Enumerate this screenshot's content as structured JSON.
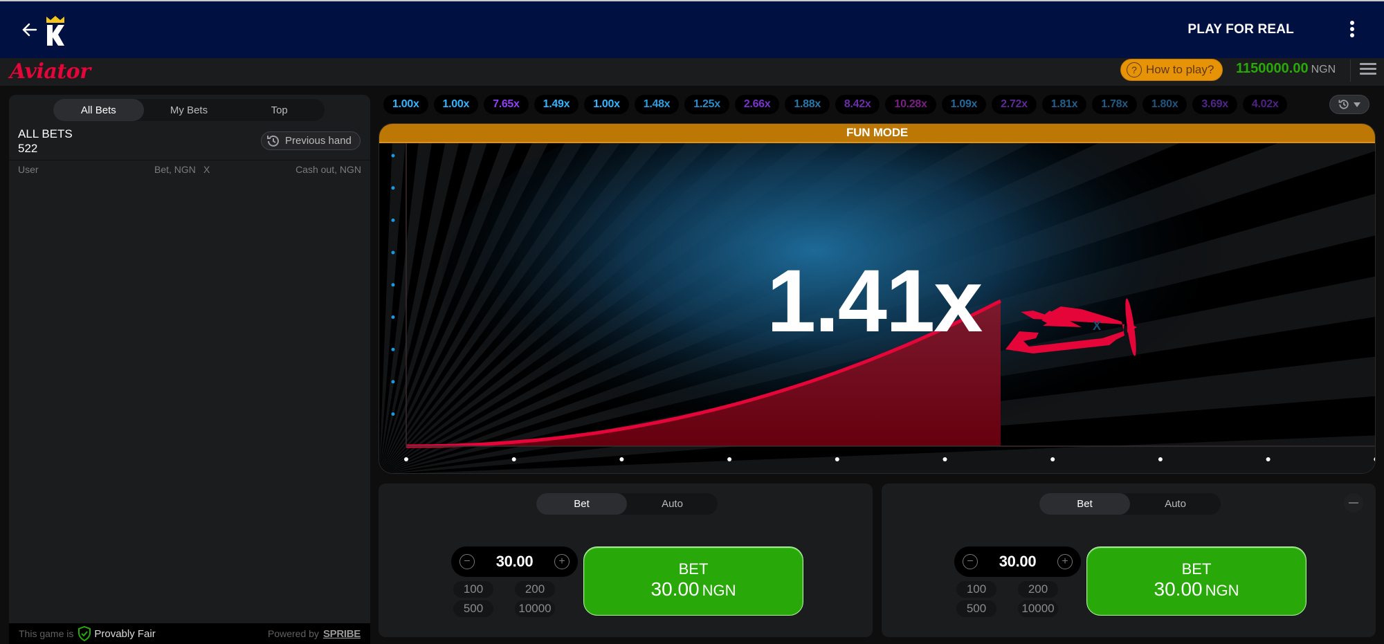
{
  "topnav": {
    "back_icon": "arrow-left-icon",
    "logo_icon": "crown-k-logo-icon",
    "play_for_real": "PLAY FOR REAL",
    "more_icon": "kebab-menu-icon"
  },
  "gamebar": {
    "logo_text": "Aviator",
    "how_to_play": "How to play?",
    "how_to_play_icon": "question-circle-icon",
    "balance": "1150000.00",
    "currency": "NGN",
    "menu_icon": "hamburger-menu-icon"
  },
  "bets_panel": {
    "tabs": [
      {
        "label": "All Bets",
        "active": true
      },
      {
        "label": "My Bets",
        "active": false
      },
      {
        "label": "Top",
        "active": false
      }
    ],
    "title": "ALL BETS",
    "count": "522",
    "previous_hand": "Previous hand",
    "columns": {
      "user": "User",
      "bet": "Bet, NGN",
      "x": "X",
      "cashout": "Cash out, NGN"
    },
    "rows": [],
    "footer": {
      "prefix": "This game is",
      "provably_fair": "Provably Fair",
      "powered_by": "Powered by",
      "provider": "SPRIBE"
    }
  },
  "history": {
    "multipliers": [
      {
        "value": "1.00x",
        "color": "#34b4ff"
      },
      {
        "value": "1.00x",
        "color": "#34b4ff"
      },
      {
        "value": "7.65x",
        "color": "#913ef8"
      },
      {
        "value": "1.49x",
        "color": "#34b4ff"
      },
      {
        "value": "1.00x",
        "color": "#34b4ff"
      },
      {
        "value": "1.48x",
        "color": "#2f9ee0"
      },
      {
        "value": "1.25x",
        "color": "#2b8cc7"
      },
      {
        "value": "2.66x",
        "color": "#7a33cf"
      },
      {
        "value": "1.88x",
        "color": "#2877a8"
      },
      {
        "value": "8.42x",
        "color": "#6a2ea8"
      },
      {
        "value": "10.28x",
        "color": "#7a1f83"
      },
      {
        "value": "1.09x",
        "color": "#25699a"
      },
      {
        "value": "2.72x",
        "color": "#5e2a99"
      },
      {
        "value": "1.81x",
        "color": "#235f8c"
      },
      {
        "value": "1.78x",
        "color": "#225a86"
      },
      {
        "value": "1.80x",
        "color": "#21557f"
      },
      {
        "value": "3.69x",
        "color": "#52258a"
      },
      {
        "value": "4.02x",
        "color": "#4e2384"
      }
    ],
    "history_toggle_icon": "history-clock-icon"
  },
  "game": {
    "mode_banner": "FUN MODE",
    "multiplier": "1.41x",
    "plane_icon": "red-propeller-plane-icon",
    "colors": {
      "curve": "#e50539",
      "fill": "#6f0a1c",
      "y_dots": "#1c98e0",
      "x_dots": "#ffffff",
      "banner": "#bc7704"
    }
  },
  "bet_panels": [
    {
      "tabs": [
        {
          "label": "Bet",
          "active": true
        },
        {
          "label": "Auto",
          "active": false
        }
      ],
      "amount": "30.00",
      "quick_amounts": [
        "100",
        "200",
        "500",
        "10000"
      ],
      "button_label": "BET",
      "button_amount": "30.00",
      "button_currency": "NGN",
      "has_remove": false
    },
    {
      "tabs": [
        {
          "label": "Bet",
          "active": true
        },
        {
          "label": "Auto",
          "active": false
        }
      ],
      "amount": "30.00",
      "quick_amounts": [
        "100",
        "200",
        "500",
        "10000"
      ],
      "button_label": "BET",
      "button_amount": "30.00",
      "button_currency": "NGN",
      "has_remove": true
    }
  ]
}
